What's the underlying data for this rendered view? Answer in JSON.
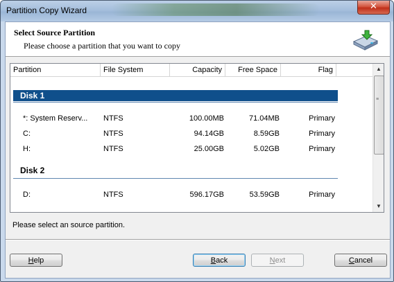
{
  "window": {
    "title": "Partition Copy Wizard",
    "close_glyph": "✕"
  },
  "header": {
    "title": "Select Source Partition",
    "subtitle": "Please choose a partition that you want to copy",
    "icon": "drive-copy-icon"
  },
  "table": {
    "columns": [
      "Partition",
      "File System",
      "Capacity",
      "Free Space",
      "Flag"
    ],
    "disks": [
      {
        "label": "Disk 1",
        "partitions": [
          {
            "partition": "*:  System Reserv...",
            "fs": "NTFS",
            "capacity": "100.00MB",
            "free": "71.04MB",
            "flag": "Primary"
          },
          {
            "partition": "C:",
            "fs": "NTFS",
            "capacity": "94.14GB",
            "free": "8.59GB",
            "flag": "Primary"
          },
          {
            "partition": "H:",
            "fs": "NTFS",
            "capacity": "25.00GB",
            "free": "5.02GB",
            "flag": "Primary"
          }
        ]
      },
      {
        "label": "Disk 2",
        "partitions": [
          {
            "partition": "D:",
            "fs": "NTFS",
            "capacity": "596.17GB",
            "free": "53.59GB",
            "flag": "Primary"
          }
        ]
      }
    ]
  },
  "status": "Please select an source partition.",
  "buttons": {
    "help_first": "H",
    "help_rest": "elp",
    "back_first": "B",
    "back_rest": "ack",
    "next_first": "N",
    "next_rest": "ext",
    "cancel_first": "C",
    "cancel_rest": "ancel"
  },
  "colors": {
    "selected_row": "#0f4f8b",
    "disk_line": "#5e86b0",
    "close": "#c0301a"
  }
}
